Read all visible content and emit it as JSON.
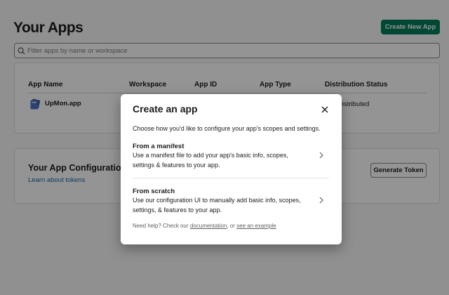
{
  "page": {
    "title": "Your Apps",
    "create_button": "Create New App",
    "filter_placeholder": "Filter apps by name or workspace"
  },
  "table": {
    "columns": [
      "App Name",
      "Workspace",
      "App ID",
      "App Type",
      "Distribution Status"
    ],
    "rows": [
      {
        "name": "UpMon.app",
        "distribution": "Distributed"
      }
    ]
  },
  "config_tokens": {
    "title": "Your App Configuration Tokens",
    "link": "Learn about tokens",
    "button": "Generate Token"
  },
  "modal": {
    "title": "Create an app",
    "subtitle": "Choose how you'd like to configure your app's scopes and settings.",
    "options": [
      {
        "title": "From a manifest",
        "description": "Use a manifest file to add your app's basic info, scopes, settings & features to your app."
      },
      {
        "title": "From scratch",
        "description": "Use our configuration UI to manually add basic info, scopes, settings, & features to your app."
      }
    ],
    "help_prefix": "Need help? Check our",
    "help_link1": "documentation",
    "help_sep": ", or",
    "help_link2": "see an example"
  },
  "colors": {
    "primary_green": "#007a5a",
    "link_blue": "#1264a3"
  }
}
